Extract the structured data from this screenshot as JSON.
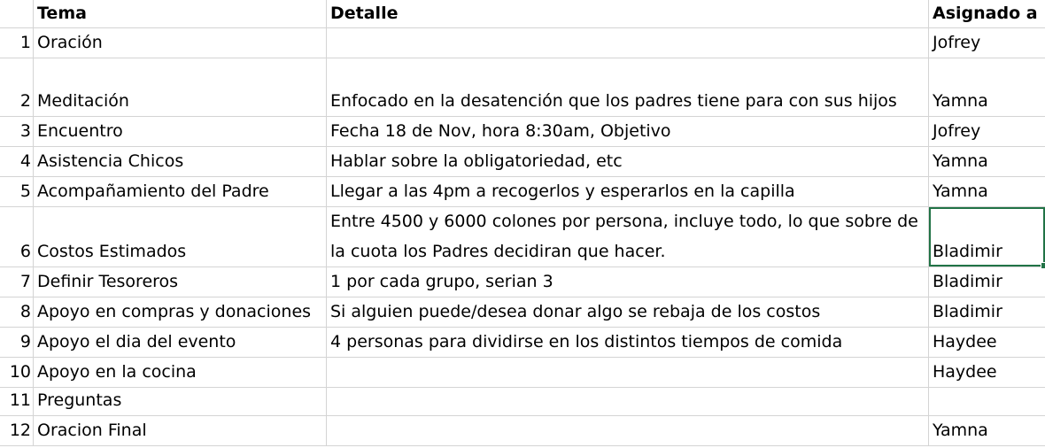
{
  "headers": {
    "num": "",
    "tema": "Tema",
    "detalle": "Detalle",
    "asignado": "Asignado a"
  },
  "rows": [
    {
      "num": "1",
      "tema": "Oración",
      "detalle": [
        ""
      ],
      "asignado": "Jofrey"
    },
    {
      "num": "2",
      "tema": "Meditación",
      "detalle": [
        "Enfocado en la desatención que los padres tiene para con sus hijos"
      ],
      "asignado": "Yamna"
    },
    {
      "num": "3",
      "tema": "Encuentro",
      "detalle": [
        "Fecha 18 de Nov, hora 8:30am, Objetivo"
      ],
      "asignado": "Jofrey"
    },
    {
      "num": "4",
      "tema": "Asistencia Chicos",
      "detalle": [
        "Hablar sobre la obligatoriedad, etc"
      ],
      "asignado": "Yamna"
    },
    {
      "num": "5",
      "tema": "Acompañamiento del Padre",
      "detalle": [
        "Llegar a las 4pm a recogerlos y esperarlos en la capilla"
      ],
      "asignado": "Yamna"
    },
    {
      "num": "6",
      "tema": "Costos Estimados",
      "detalle": [
        "Entre 4500 y 6000 colones por persona, incluye todo, lo que sobre de",
        "la cuota los Padres decidiran que hacer."
      ],
      "asignado": "Bladimir"
    },
    {
      "num": "7",
      "tema": "Definir Tesoreros",
      "detalle": [
        "1 por cada grupo, serian 3"
      ],
      "asignado": "Bladimir"
    },
    {
      "num": "8",
      "tema": "Apoyo en compras y donaciones",
      "detalle": [
        "Si alguien puede/desea donar algo se rebaja de los costos"
      ],
      "asignado": "Bladimir"
    },
    {
      "num": "9",
      "tema": "Apoyo el dia del evento",
      "detalle": [
        "4 personas para dividirse en los distintos tiempos de comida"
      ],
      "asignado": "Haydee"
    },
    {
      "num": "10",
      "tema": "Apoyo en la cocina",
      "detalle": [
        ""
      ],
      "asignado": "Haydee"
    },
    {
      "num": "11",
      "tema": "Preguntas",
      "detalle": [
        ""
      ],
      "asignado": ""
    },
    {
      "num": "12",
      "tema": "Oracion Final",
      "detalle": [
        ""
      ],
      "asignado": "Yamna"
    }
  ],
  "colors": {
    "gridline": "#d4d4d4",
    "selection": "#217346"
  }
}
